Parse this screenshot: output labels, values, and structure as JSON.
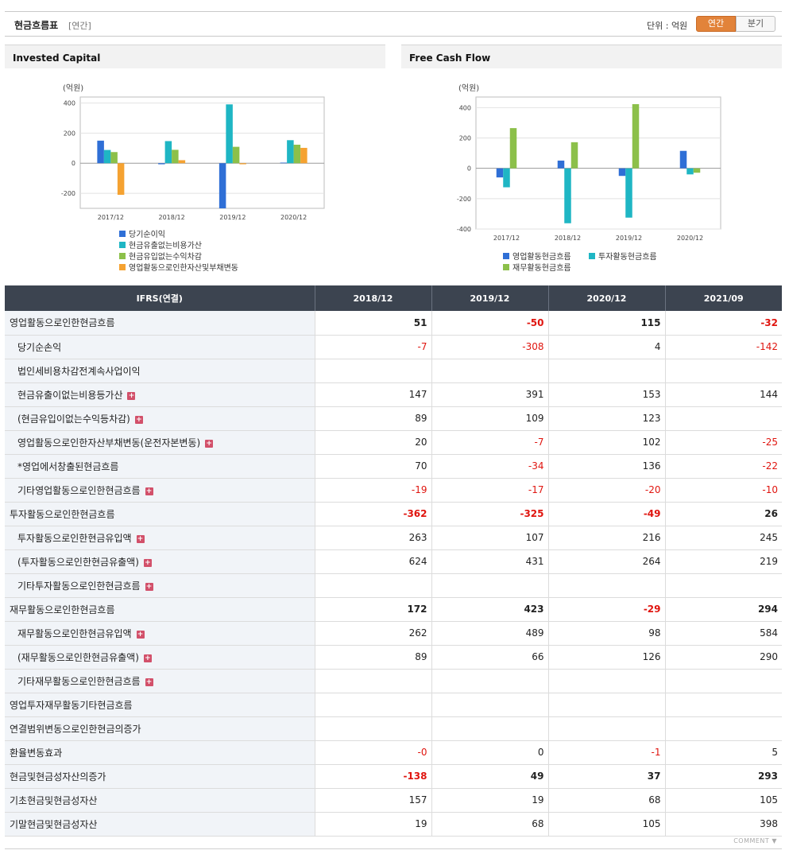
{
  "header": {
    "title": "현금흐름표",
    "period_tag": "[연간]",
    "unit_label": "단위 : 억원",
    "tab_annual": "연간",
    "tab_quarter": "분기"
  },
  "chart_data": [
    {
      "type": "bar",
      "title": "Invested Capital",
      "ylabel": "(억원)",
      "categories": [
        "2017/12",
        "2018/12",
        "2019/12",
        "2020/12"
      ],
      "ylim": [
        -300,
        440
      ],
      "yticks": [
        400,
        200,
        0,
        -200
      ],
      "series": [
        {
          "name": "당기순이익",
          "color": "#2f6fd6",
          "values": [
            150,
            -7,
            -300,
            4
          ]
        },
        {
          "name": "현금유출없는비용가산",
          "color": "#1fb6c4",
          "values": [
            88,
            147,
            391,
            153
          ]
        },
        {
          "name": "현금유입없는수익차감",
          "color": "#8cc04a",
          "values": [
            74,
            89,
            109,
            123
          ]
        },
        {
          "name": "영업활동으로인한자산및부채변동",
          "color": "#f5a231",
          "values": [
            -210,
            20,
            -7,
            102
          ]
        }
      ],
      "legend": "bottom"
    },
    {
      "type": "bar",
      "title": "Free Cash Flow",
      "ylabel": "(억원)",
      "categories": [
        "2017/12",
        "2018/12",
        "2019/12",
        "2020/12"
      ],
      "ylim": [
        -400,
        470
      ],
      "yticks": [
        400,
        200,
        0,
        -200,
        -400
      ],
      "series": [
        {
          "name": "영업활동현금흐름",
          "color": "#2f6fd6",
          "values": [
            -60,
            51,
            -50,
            115
          ]
        },
        {
          "name": "투자활동현금흐름",
          "color": "#1fb6c4",
          "values": [
            -125,
            -362,
            -325,
            -40
          ]
        },
        {
          "name": "재무활동현금흐름",
          "color": "#8cc04a",
          "values": [
            265,
            172,
            423,
            -29
          ]
        }
      ],
      "legend": "bottom"
    }
  ],
  "table": {
    "corner": "IFRS(연결)",
    "columns": [
      "2018/12",
      "2019/12",
      "2020/12",
      "2021/09"
    ],
    "rows": [
      {
        "label": "영업활동으로인한현금흐름",
        "level": 0,
        "plus": false,
        "values": [
          "51",
          "-50",
          "115",
          "-32"
        ]
      },
      {
        "label": "당기순손익",
        "level": 1,
        "plus": false,
        "values": [
          "-7",
          "-308",
          "4",
          "-142"
        ]
      },
      {
        "label": "법인세비용차감전계속사업이익",
        "level": 1,
        "plus": false,
        "values": [
          "",
          "",
          "",
          ""
        ]
      },
      {
        "label": "현금유출이없는비용등가산",
        "level": 1,
        "plus": true,
        "values": [
          "147",
          "391",
          "153",
          "144"
        ]
      },
      {
        "label": "(현금유입이없는수익등차감)",
        "level": 1,
        "plus": true,
        "values": [
          "89",
          "109",
          "123",
          ""
        ]
      },
      {
        "label": "영업활동으로인한자산부채변동(운전자본변동)",
        "level": 1,
        "plus": true,
        "values": [
          "20",
          "-7",
          "102",
          "-25"
        ]
      },
      {
        "label": "*영업에서창출된현금흐름",
        "level": 1,
        "plus": false,
        "values": [
          "70",
          "-34",
          "136",
          "-22"
        ]
      },
      {
        "label": "기타영업활동으로인한현금흐름",
        "level": 1,
        "plus": true,
        "values": [
          "-19",
          "-17",
          "-20",
          "-10"
        ]
      },
      {
        "label": "투자활동으로인한현금흐름",
        "level": 0,
        "plus": false,
        "values": [
          "-362",
          "-325",
          "-49",
          "26"
        ]
      },
      {
        "label": "투자활동으로인한현금유입액",
        "level": 1,
        "plus": true,
        "values": [
          "263",
          "107",
          "216",
          "245"
        ]
      },
      {
        "label": "(투자활동으로인한현금유출액)",
        "level": 1,
        "plus": true,
        "values": [
          "624",
          "431",
          "264",
          "219"
        ]
      },
      {
        "label": "기타투자활동으로인한현금흐름",
        "level": 1,
        "plus": true,
        "values": [
          "",
          "",
          "",
          ""
        ]
      },
      {
        "label": "재무활동으로인한현금흐름",
        "level": 0,
        "plus": false,
        "values": [
          "172",
          "423",
          "-29",
          "294"
        ]
      },
      {
        "label": "재무활동으로인한현금유입액",
        "level": 1,
        "plus": true,
        "values": [
          "262",
          "489",
          "98",
          "584"
        ]
      },
      {
        "label": "(재무활동으로인한현금유출액)",
        "level": 1,
        "plus": true,
        "values": [
          "89",
          "66",
          "126",
          "290"
        ]
      },
      {
        "label": "기타재무활동으로인한현금흐름",
        "level": 1,
        "plus": true,
        "values": [
          "",
          "",
          "",
          ""
        ]
      },
      {
        "label": "영업투자재무활동기타현금흐름",
        "level": 0,
        "plus": false,
        "values": [
          "",
          "",
          "",
          ""
        ]
      },
      {
        "label": "연결범위변동으로인한현금의증가",
        "level": 0,
        "plus": false,
        "values": [
          "",
          "",
          "",
          ""
        ]
      },
      {
        "label": "환율변동효과",
        "level": 0,
        "plus": false,
        "values": [
          "-0",
          "0",
          "-1",
          "5"
        ]
      },
      {
        "label": "현금및현금성자산의증가",
        "level": 0,
        "plus": false,
        "bold": true,
        "values": [
          "-138",
          "49",
          "37",
          "293"
        ]
      },
      {
        "label": "기초현금및현금성자산",
        "level": 0,
        "plus": false,
        "values": [
          "157",
          "19",
          "68",
          "105"
        ]
      },
      {
        "label": "기말현금및현금성자산",
        "level": 0,
        "plus": false,
        "values": [
          "19",
          "68",
          "105",
          "398"
        ]
      }
    ]
  },
  "footer": {
    "comment_label": "COMMENT ▼"
  }
}
